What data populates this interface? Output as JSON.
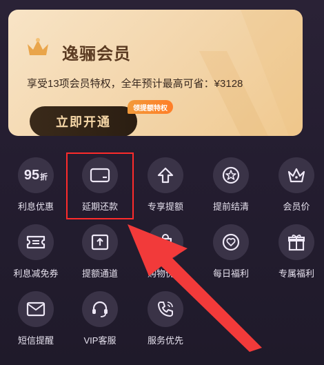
{
  "colors": {
    "accent_red": "#ff2b2b",
    "card_gold": "#f3d6ac",
    "badge_orange": "#ff7e28",
    "background": "#241d30"
  },
  "membership_card": {
    "title": "逸骊会员",
    "subtitle": "享受13项会员特权，全年预计最高可省：¥3128",
    "open_button": "立即开通",
    "badge": "领提额特权"
  },
  "grid": {
    "items": [
      {
        "label": "利息优惠",
        "icon": "discount-95-icon",
        "icon_text": "95",
        "icon_suffix": "折"
      },
      {
        "label": "延期还款",
        "icon": "card-icon"
      },
      {
        "label": "专享提额",
        "icon": "arrow-up-icon"
      },
      {
        "label": "提前结清",
        "icon": "star-badge-icon"
      },
      {
        "label": "会员价",
        "icon": "crown-icon"
      },
      {
        "label": "利息减免券",
        "icon": "ticket-icon"
      },
      {
        "label": "提额通道",
        "icon": "upload-icon"
      },
      {
        "label": "购物优惠",
        "icon": "shopping-icon"
      },
      {
        "label": "每日福利",
        "icon": "heart-icon"
      },
      {
        "label": "专属福利",
        "icon": "gift-icon"
      },
      {
        "label": "短信提醒",
        "icon": "mail-icon"
      },
      {
        "label": "VIP客服",
        "icon": "headset-icon"
      },
      {
        "label": "服务优先",
        "icon": "phone-icon"
      }
    ]
  }
}
